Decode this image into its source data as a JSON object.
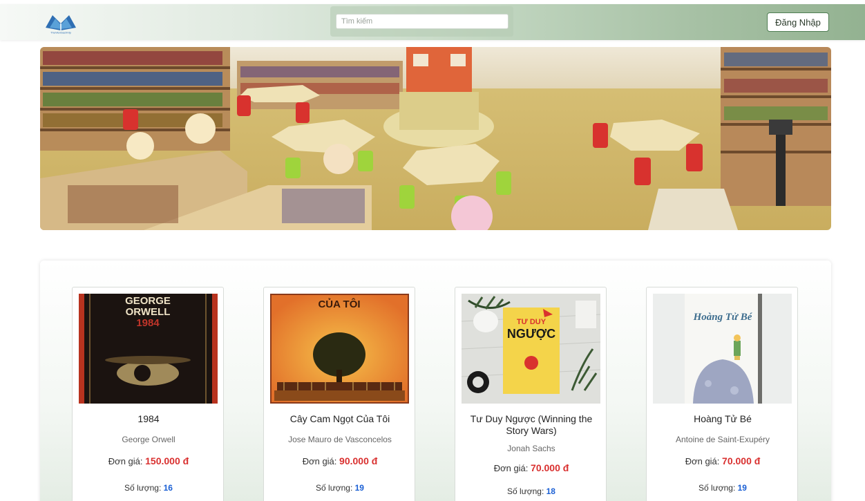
{
  "header": {
    "logo_text": "ThuVienSachVip",
    "search_placeholder": "Tìm kiếm",
    "login_label": "Đăng Nhập"
  },
  "books": [
    {
      "title": "1984",
      "author": "George Orwell",
      "price_label": "Đơn giá:",
      "price": "150.000 đ",
      "qty_label": "Số lượng:",
      "qty": "16",
      "cover_text": [
        "GEORGE",
        "ORWELL",
        "1984"
      ]
    },
    {
      "title": "Cây Cam Ngọt Của Tôi",
      "author": "Jose Mauro de Vasconcelos",
      "price_label": "Đơn giá:",
      "price": "90.000 đ",
      "qty_label": "Số lượng:",
      "qty": "19",
      "cover_text": [
        "CỦA TÔI"
      ]
    },
    {
      "title": "Tư Duy Ngược (Winning the Story Wars)",
      "author": "Jonah Sachs",
      "price_label": "Đơn giá:",
      "price": "70.000 đ",
      "qty_label": "Số lượng:",
      "qty": "18",
      "cover_text": [
        "TƯ DUY",
        "NGƯỢC"
      ]
    },
    {
      "title": "Hoàng Tử Bé",
      "author": "Antoine de Saint-Exupéry",
      "price_label": "Đơn giá:",
      "price": "70.000 đ",
      "qty_label": "Số lượng:",
      "qty": "19",
      "cover_text": [
        "Hoàng Tử Bé"
      ]
    }
  ],
  "colors": {
    "accent_green": "#4e7d52",
    "price_red": "#d9302f",
    "qty_blue": "#1a5fd4"
  }
}
